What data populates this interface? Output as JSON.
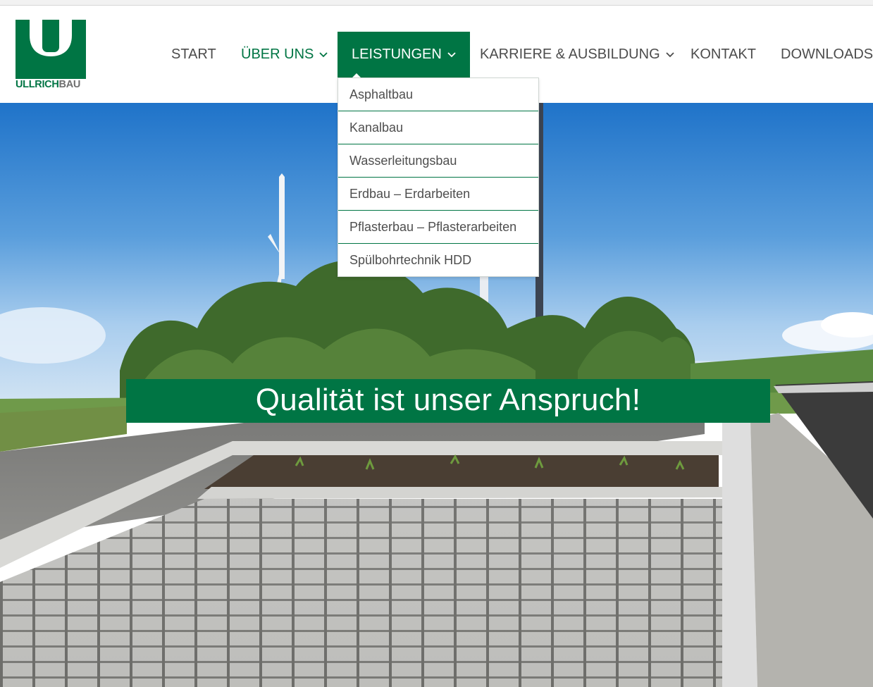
{
  "brand": {
    "name_part1": "ULLRICH",
    "name_part2": "BAU",
    "color_green": "#007544",
    "color_gray": "#6f6f6f"
  },
  "nav": {
    "items": [
      {
        "label": "START",
        "has_submenu": false,
        "state": "default"
      },
      {
        "label": "ÜBER UNS",
        "has_submenu": true,
        "state": "current"
      },
      {
        "label": "LEISTUNGEN",
        "has_submenu": true,
        "state": "open"
      },
      {
        "label": "KARRIERE & AUSBILDUNG",
        "has_submenu": true,
        "state": "default"
      },
      {
        "label": "KONTAKT",
        "has_submenu": false,
        "state": "default"
      },
      {
        "label": "DOWNLOADS",
        "has_submenu": false,
        "state": "default"
      }
    ],
    "chevron_icon": "chevron-down-icon"
  },
  "dropdown": {
    "parent": "LEISTUNGEN",
    "items": [
      "Asphaltbau",
      "Kanalbau",
      "Wasserleitungsbau",
      "Erdbau – Erdarbeiten",
      "Pflasterbau – Pflasterarbeiten",
      "Spülbohrtechnik HDD"
    ]
  },
  "hero": {
    "headline": "Qualität ist unser Anspruch!",
    "image": "paved-road-with-wind-turbine-photo"
  }
}
